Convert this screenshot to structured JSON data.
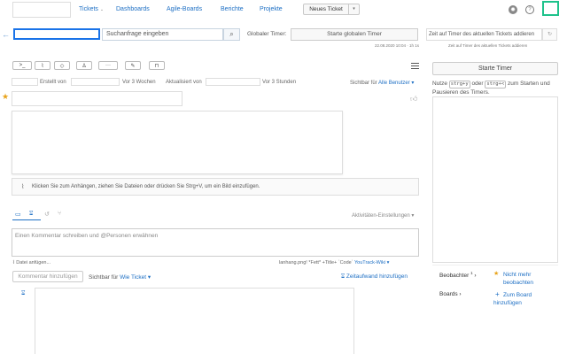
{
  "nav": {
    "tickets": "Tickets",
    "dashboards": "Dashboards",
    "agile_boards": "Agile-Boards",
    "reports": "Berichte",
    "projects": "Projekte",
    "new_ticket": "Neues Ticket"
  },
  "search": {
    "placeholder": "Suchanfrage eingeben"
  },
  "timer": {
    "global_label": "Globaler Timer:",
    "start_global": "Starte globalen Timer",
    "add_time": "Zeit auf Timer des aktuellen Tickets addieren",
    "date": "22.08.2020 10:04 · 1h 1s",
    "hint": "Zeit auf Timer des aktuellen Tickets addieren"
  },
  "toolbar": {
    "command": ">_",
    "link": "🔗",
    "tag": "⌖",
    "assign": "♟",
    "more": "···",
    "edit": "✎",
    "delete": "🗑"
  },
  "meta": {
    "created_by": "Erstellt von",
    "created_ago": "Vor 3 Wochen",
    "updated_by": "Aktualisiert von",
    "updated_ago": "Vor 3 Stunden",
    "visible_prefix": "Sichtbar für",
    "visible_value": "Alle Benutzer"
  },
  "attach": {
    "text": "Klicken Sie zum Anhängen, ziehen Sie Dateien oder drücken Sie Strg+V, um ein Bild einzufügen."
  },
  "activity": {
    "settings": "Aktivitäten-Einstellungen"
  },
  "comment": {
    "placeholder": "Einen Kommentar schreiben und @Personen erwähnen",
    "attach_file": "Datei anfügen...",
    "markup_prefix": "lanhang.png! *Fett* +Title+ `Code`",
    "markup_link": "YouTrack-Wiki",
    "add_button": "Kommentar hinzufügen",
    "visible_prefix": "Sichtbar für",
    "visible_value": "Wie Ticket",
    "add_work": "Zeitaufwand hinzufügen"
  },
  "right": {
    "start_timer": "Starte Timer",
    "use": "Nutze",
    "key1": "strg+y",
    "or": "oder",
    "key2": "strg+<",
    "rest": "zum Starten und Pausieren des Timers.",
    "watchers_label": "Beobachter",
    "watchers_count": "1",
    "not_watching": "Nicht mehr beobachten",
    "boards_label": "Boards",
    "add_board": "Zum Board hinzufügen"
  }
}
